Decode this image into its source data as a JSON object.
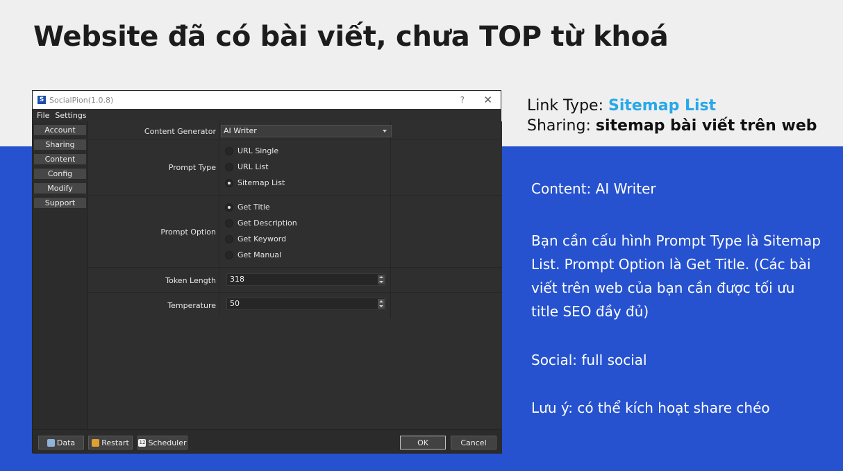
{
  "slide": {
    "title": "Website đã có bài viết, chưa TOP từ khoá",
    "link_type_label": "Link Type: ",
    "link_type_value": "Sitemap List",
    "sharing_label": "Sharing: ",
    "sharing_value": "sitemap bài viết trên web",
    "content_line": "Content: AI Writer",
    "instructions": "Bạn cần cấu hình Prompt Type là Sitemap List. Prompt Option là Get Title. (Các bài viết trên web của bạn cần được tối ưu title SEO đầy đủ)",
    "social_line": "Social: full social",
    "note_line": "Lưu ý: có thể kích hoạt share chéo",
    "colors": {
      "background_top": "#efefef",
      "background_bottom": "#2652cf",
      "highlight": "#27a8e8"
    }
  },
  "app": {
    "window_title": "SocialPion(1.0.8)",
    "title_icon": "socialpion-logo-icon",
    "help_glyph": "?",
    "close_glyph": "✕",
    "menu": [
      "File",
      "Settings"
    ],
    "sidebar": [
      "Account",
      "Sharing",
      "Content",
      "Config",
      "Modify",
      "Support"
    ],
    "form": {
      "content_generator_label": "Content Generator",
      "content_generator_value": "AI Writer",
      "prompt_type_label": "Prompt Type",
      "prompt_type_options": [
        "URL Single",
        "URL List",
        "Sitemap List"
      ],
      "prompt_type_selected": "Sitemap List",
      "prompt_option_label": "Prompt Option",
      "prompt_option_options": [
        "Get Title",
        "Get Description",
        "Get Keyword",
        "Get Manual"
      ],
      "prompt_option_selected": "Get Title",
      "token_length_label": "Token Length",
      "token_length_value": "318",
      "temperature_label": "Temperature",
      "temperature_value": "50"
    },
    "bottom": {
      "data_label": "Data",
      "restart_label": "Restart",
      "scheduler_label": "Scheduler",
      "scheduler_icon_text": "12",
      "ok_label": "OK",
      "cancel_label": "Cancel"
    }
  }
}
